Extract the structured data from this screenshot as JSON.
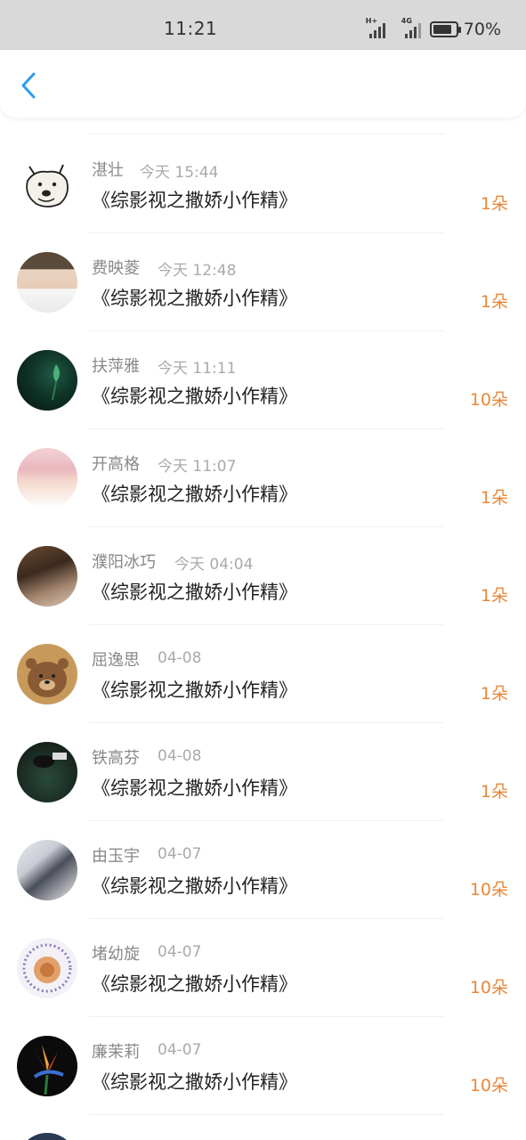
{
  "status_bar": {
    "time": "11:21",
    "net1": "H+",
    "net2": "4G",
    "battery": "70%"
  },
  "nav": {
    "back_icon": "chevron-left-icon",
    "accent": "#2a9df4"
  },
  "colors": {
    "count": "#e8883a",
    "name": "#888888",
    "time": "#aaaaaa"
  },
  "items": [
    {
      "name": "湛壮",
      "time": "今天 15:44",
      "title": "《综影视之撒娇小作精》",
      "count": "1朵"
    },
    {
      "name": "费映菱",
      "time": "今天 12:48",
      "title": "《综影视之撒娇小作精》",
      "count": "1朵"
    },
    {
      "name": "扶萍雅",
      "time": "今天 11:11",
      "title": "《综影视之撒娇小作精》",
      "count": "10朵"
    },
    {
      "name": "开高格",
      "time": "今天 11:07",
      "title": "《综影视之撒娇小作精》",
      "count": "1朵"
    },
    {
      "name": "濮阳冰巧",
      "time": "今天 04:04",
      "title": "《综影视之撒娇小作精》",
      "count": "1朵"
    },
    {
      "name": "屈逸思",
      "time": "04-08",
      "title": "《综影视之撒娇小作精》",
      "count": "1朵"
    },
    {
      "name": "铁高芬",
      "time": "04-08",
      "title": "《综影视之撒娇小作精》",
      "count": "1朵"
    },
    {
      "name": "由玉宇",
      "time": "04-07",
      "title": "《综影视之撒娇小作精》",
      "count": "10朵"
    },
    {
      "name": "堵幼旋",
      "time": "04-07",
      "title": "《综影视之撒娇小作精》",
      "count": "10朵"
    },
    {
      "name": "廉茉莉",
      "time": "04-07",
      "title": "《综影视之撒娇小作精》",
      "count": "10朵"
    }
  ]
}
